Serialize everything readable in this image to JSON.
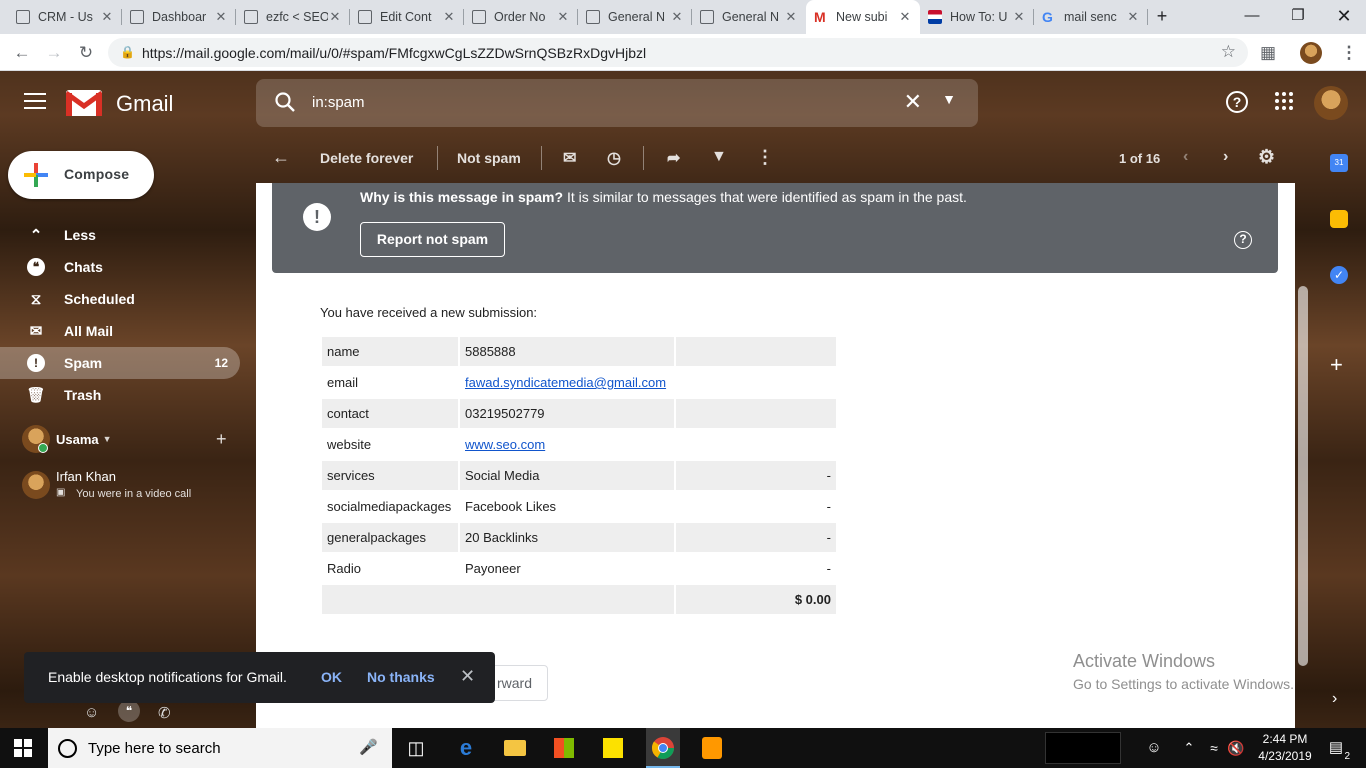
{
  "browser": {
    "tabs": [
      {
        "title": "CRM - Us",
        "favicon": "page-icon"
      },
      {
        "title": "Dashboar",
        "favicon": "page-icon"
      },
      {
        "title": "ezfc < SEO",
        "favicon": "page-icon"
      },
      {
        "title": "Edit Cont",
        "favicon": "page-icon"
      },
      {
        "title": "Order No",
        "favicon": "page-icon"
      },
      {
        "title": "General N",
        "favicon": "page-icon"
      },
      {
        "title": "General N",
        "favicon": "page-icon"
      },
      {
        "title": "New subi",
        "favicon": "gmail-icon"
      },
      {
        "title": "How To: U",
        "favicon": "flag-icon"
      },
      {
        "title": "mail senc",
        "favicon": "google-icon"
      }
    ],
    "new_tab": "+",
    "url": "https://mail.google.com/mail/u/0/#spam/FMfcgxwCgLsZZDwSrnQSBzRxDgvHjbzl"
  },
  "gmail": {
    "brand": "Gmail",
    "search_value": "in:spam",
    "compose_label": "Compose",
    "nav": [
      {
        "label": "Less",
        "icon": "chevron-up-icon",
        "count": ""
      },
      {
        "label": "Chats",
        "icon": "chat-icon",
        "count": ""
      },
      {
        "label": "Scheduled",
        "icon": "scheduled-icon",
        "count": ""
      },
      {
        "label": "All Mail",
        "icon": "mail-icon",
        "count": ""
      },
      {
        "label": "Spam",
        "icon": "spam-icon",
        "count": "12"
      },
      {
        "label": "Trash",
        "icon": "trash-icon",
        "count": ""
      }
    ],
    "hangouts": {
      "user": "Usama",
      "contact_name": "Irfan Khan",
      "contact_status": "You were in a video call"
    },
    "toolbar": {
      "delete_forever": "Delete forever",
      "not_spam": "Not spam",
      "pager": "1 of 16"
    },
    "spam_banner": {
      "bold": "Why is this message in spam?",
      "text": " It is similar to messages that were identified as spam in the past.",
      "button": "Report not spam"
    },
    "message": {
      "intro": "You have received a new submission:",
      "rows": [
        {
          "label": "name",
          "value": "5885888",
          "extra": "",
          "shaded": true,
          "link": false
        },
        {
          "label": "email",
          "value": "fawad.syndicatemedia@gmail.com",
          "extra": "",
          "shaded": false,
          "link": true
        },
        {
          "label": "contact",
          "value": "03219502779",
          "extra": "",
          "shaded": true,
          "link": false
        },
        {
          "label": "website",
          "value": "www.seo.com",
          "extra": "",
          "shaded": false,
          "link": true
        },
        {
          "label": "services",
          "value": "Social Media",
          "extra": "-",
          "shaded": true,
          "link": false
        },
        {
          "label": "socialmediapackages",
          "value": "Facebook Likes",
          "extra": "-",
          "shaded": false,
          "link": false
        },
        {
          "label": "generalpackages",
          "value": "20 Backlinks",
          "extra": "-",
          "shaded": true,
          "link": false
        },
        {
          "label": "Radio",
          "value": "Payoneer",
          "extra": "-",
          "shaded": false,
          "link": false
        }
      ],
      "total": "$ 0.00",
      "forward_label": "rward"
    },
    "snackbar": {
      "text": "Enable desktop notifications for Gmail.",
      "ok": "OK",
      "no": "No thanks"
    }
  },
  "watermark": {
    "line1": "Activate Windows",
    "line2": "Go to Settings to activate Windows."
  },
  "taskbar": {
    "search_placeholder": "Type here to search",
    "time": "2:44 PM",
    "date": "4/23/2019",
    "notifications": "2"
  },
  "colors": {
    "gmail_red": "#d93025",
    "link": "#1155cc",
    "snackbar_action": "#8ab4f8",
    "spam_banner": "#5f6368"
  }
}
